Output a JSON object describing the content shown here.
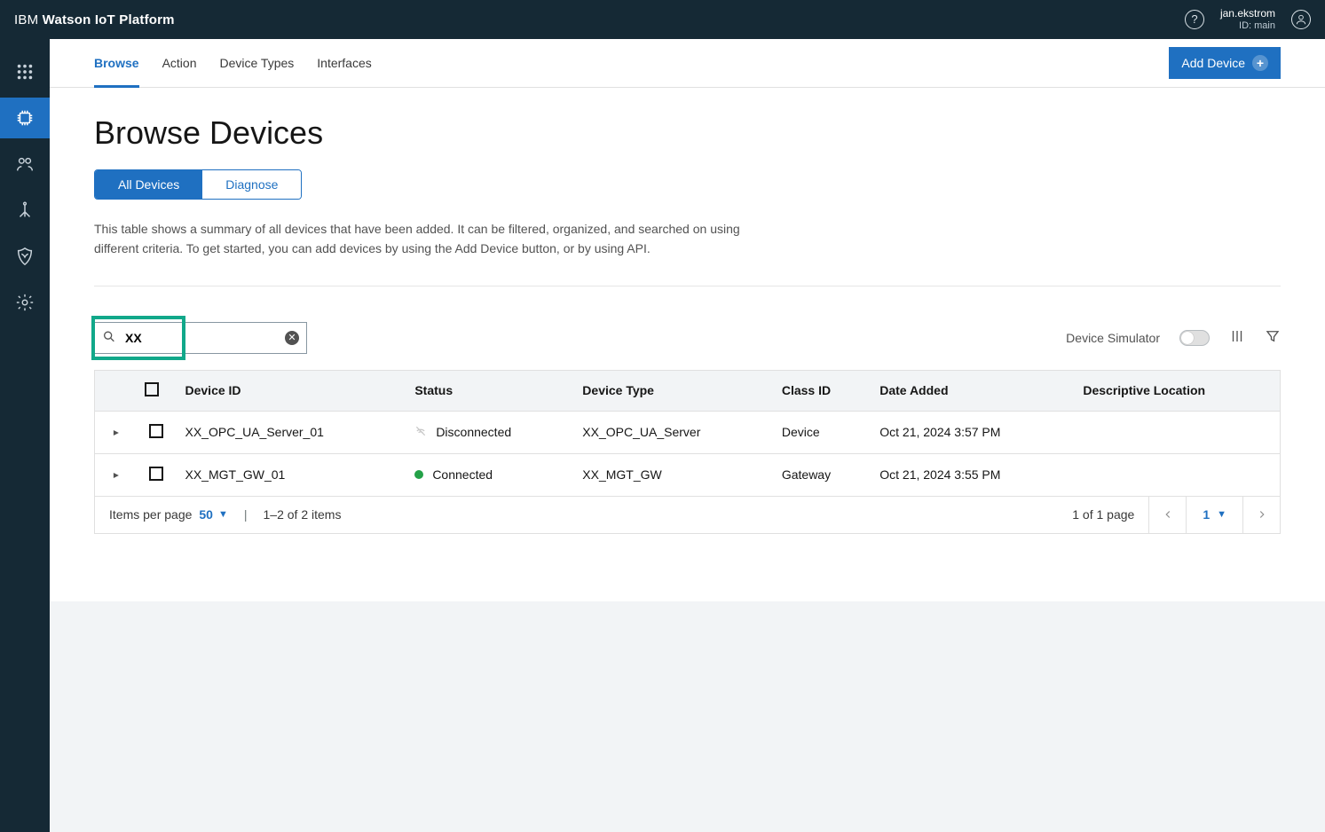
{
  "header": {
    "brand_prefix": "IBM ",
    "brand_bold": "Watson IoT Platform",
    "user_name": "jan.ekstrom",
    "user_id_label": "ID: main"
  },
  "subnav": {
    "tabs": [
      {
        "label": "Browse",
        "active": true
      },
      {
        "label": "Action",
        "active": false
      },
      {
        "label": "Device Types",
        "active": false
      },
      {
        "label": "Interfaces",
        "active": false
      }
    ],
    "add_device_label": "Add Device"
  },
  "page": {
    "title": "Browse Devices",
    "pills": {
      "all_devices": "All Devices",
      "diagnose": "Diagnose"
    },
    "description": "This table shows a summary of all devices that have been added. It can be filtered, organized, and searched on using different criteria. To get started, you can add devices by using the Add Device button, or by using API."
  },
  "toolbar": {
    "search_value": "XX",
    "device_simulator_label": "Device Simulator"
  },
  "table": {
    "headers": {
      "device_id": "Device ID",
      "status": "Status",
      "device_type": "Device Type",
      "class_id": "Class ID",
      "date_added": "Date Added",
      "descriptive_location": "Descriptive Location"
    },
    "rows": [
      {
        "device_id": "XX_OPC_UA_Server_01",
        "status": "Disconnected",
        "status_kind": "disconnected",
        "device_type": "XX_OPC_UA_Server",
        "class_id": "Device",
        "date_added": "Oct 21, 2024 3:57 PM",
        "descriptive_location": ""
      },
      {
        "device_id": "XX_MGT_GW_01",
        "status": "Connected",
        "status_kind": "connected",
        "device_type": "XX_MGT_GW",
        "class_id": "Gateway",
        "date_added": "Oct 21, 2024 3:55 PM",
        "descriptive_location": ""
      }
    ]
  },
  "footer": {
    "items_per_page_label": "Items per page",
    "items_per_page_value": "50",
    "range_text": "1–2 of 2 items",
    "page_info": "1 of 1 page",
    "current_page": "1"
  }
}
